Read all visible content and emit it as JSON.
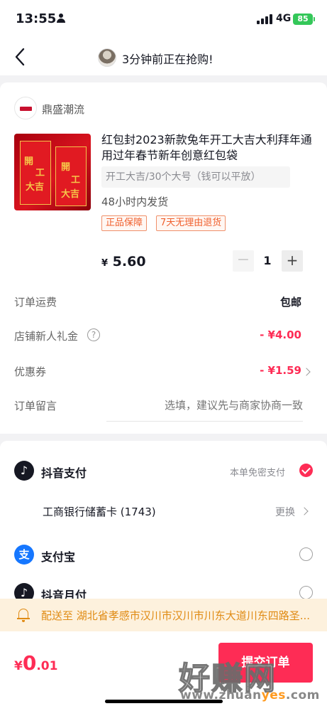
{
  "status_bar": {
    "time": "13:55",
    "network": "4G",
    "battery": "85"
  },
  "nav": {
    "title": "3分钟前正在抢购!"
  },
  "shop": {
    "name": "鼎盛潮流"
  },
  "product": {
    "image_text_1": "開",
    "image_text_2": "工",
    "image_text_3": "大吉",
    "title": "红包封2023新款兔年开工大吉大利拜年通用过年春节新年创意红包袋",
    "spec": "开工大吉/30个大号（钱可以平放）",
    "shipping_time": "48小时内发货",
    "tags": [
      "正品保障",
      "7天无理由退货"
    ],
    "price_symbol": "¥",
    "price": "5.60",
    "quantity": "1",
    "minus": "−",
    "plus": "+"
  },
  "order": {
    "freight_label": "订单运费",
    "freight_value": "包邮",
    "gift_label": "店铺新人礼金",
    "gift_help": "?",
    "gift_value": "- ¥4.00",
    "coupon_label": "优惠券",
    "coupon_value": "- ¥1.59",
    "note_label": "订单留言",
    "note_placeholder": "选填，建议先与商家协商一致"
  },
  "payment": {
    "douyin_pay": {
      "icon": "♪",
      "name": "抖音支付",
      "hint": "本单免密支付",
      "checked": true
    },
    "bank_card": {
      "name": "工商银行储蓄卡 (1743)",
      "action": "更换"
    },
    "alipay": {
      "icon": "支",
      "name": "支付宝",
      "checked": false
    },
    "douyin_monthly": {
      "icon": "♪",
      "name": "抖音月付",
      "checked": false
    }
  },
  "address": {
    "text": "配送至 湖北省孝感市汉川市汉川市川东大道川东四路圣..."
  },
  "bottom": {
    "currency": "¥",
    "total_int": "0",
    "total_dec": ".01",
    "submit": "提交订单"
  },
  "watermark": {
    "big": "好赚网",
    "url_pre": "www.zhuan",
    "url_hl": "yes",
    "url_post": ".com"
  },
  "colors": {
    "accent": "#fe2c55",
    "notice": "#e08b14",
    "alipay": "#1677ff"
  }
}
